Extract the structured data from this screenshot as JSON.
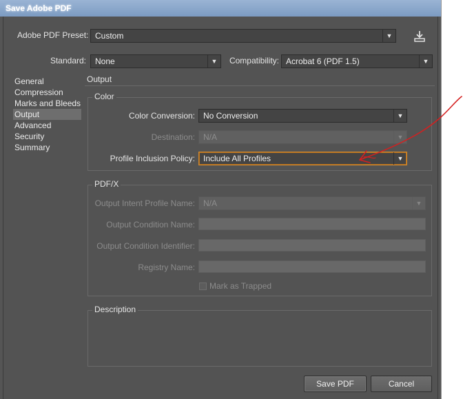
{
  "window": {
    "title": "Save Adobe PDF"
  },
  "preset": {
    "label": "Adobe PDF Preset:",
    "value": "Custom",
    "save_icon": "save-preset-icon"
  },
  "standard": {
    "label": "Standard:",
    "value": "None"
  },
  "compatibility": {
    "label": "Compatibility:",
    "value": "Acrobat 6 (PDF 1.5)"
  },
  "sidebar": {
    "items": [
      {
        "label": "General",
        "selected": false
      },
      {
        "label": "Compression",
        "selected": false
      },
      {
        "label": "Marks and Bleeds",
        "selected": false
      },
      {
        "label": "Output",
        "selected": true
      },
      {
        "label": "Advanced",
        "selected": false
      },
      {
        "label": "Security",
        "selected": false
      },
      {
        "label": "Summary",
        "selected": false
      }
    ]
  },
  "panel": {
    "title": "Output"
  },
  "color_group": {
    "title": "Color",
    "conversion": {
      "label": "Color Conversion:",
      "value": "No Conversion"
    },
    "destination": {
      "label": "Destination:",
      "value": "N/A",
      "enabled": false
    },
    "profile_policy": {
      "label": "Profile Inclusion Policy:",
      "value": "Include All Profiles"
    }
  },
  "pdfx_group": {
    "title": "PDF/X",
    "intent_profile": {
      "label": "Output Intent Profile Name:",
      "value": "N/A",
      "enabled": false
    },
    "condition_name": {
      "label": "Output Condition Name:",
      "value": ""
    },
    "condition_identifier": {
      "label": "Output Condition Identifier:",
      "value": ""
    },
    "registry_name": {
      "label": "Registry Name:",
      "value": ""
    },
    "mark_trapped": {
      "label": "Mark as Trapped",
      "checked": false,
      "enabled": false
    }
  },
  "description_group": {
    "title": "Description",
    "text": ""
  },
  "buttons": {
    "save": "Save PDF",
    "cancel": "Cancel"
  },
  "colors": {
    "dialog_bg": "#535353",
    "focus_outline": "#d48a2c",
    "annotation_arrow": "#d42020",
    "titlebar": "#8aa8cc"
  }
}
